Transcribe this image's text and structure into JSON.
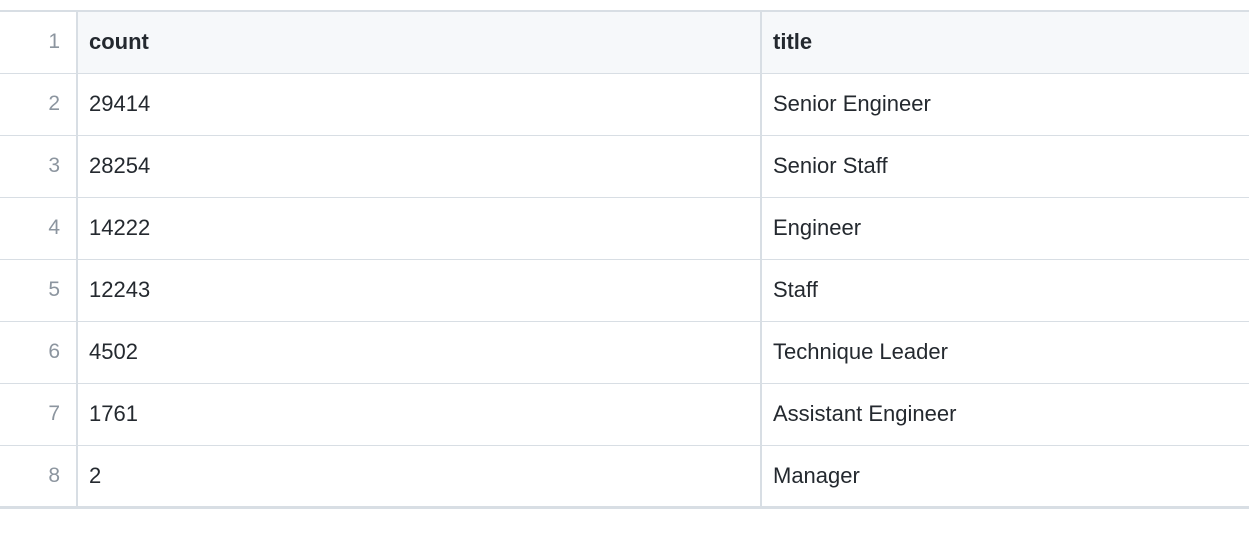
{
  "table": {
    "headers": [
      "count",
      "title"
    ],
    "line_numbers": [
      "1",
      "2",
      "3",
      "4",
      "5",
      "6",
      "7",
      "8"
    ],
    "rows": [
      {
        "count": "29414",
        "title": "Senior Engineer"
      },
      {
        "count": "28254",
        "title": "Senior Staff"
      },
      {
        "count": "14222",
        "title": "Engineer"
      },
      {
        "count": "12243",
        "title": "Staff"
      },
      {
        "count": "4502",
        "title": "Technique Leader"
      },
      {
        "count": "1761",
        "title": "Assistant Engineer"
      },
      {
        "count": "2",
        "title": "Manager"
      }
    ]
  }
}
